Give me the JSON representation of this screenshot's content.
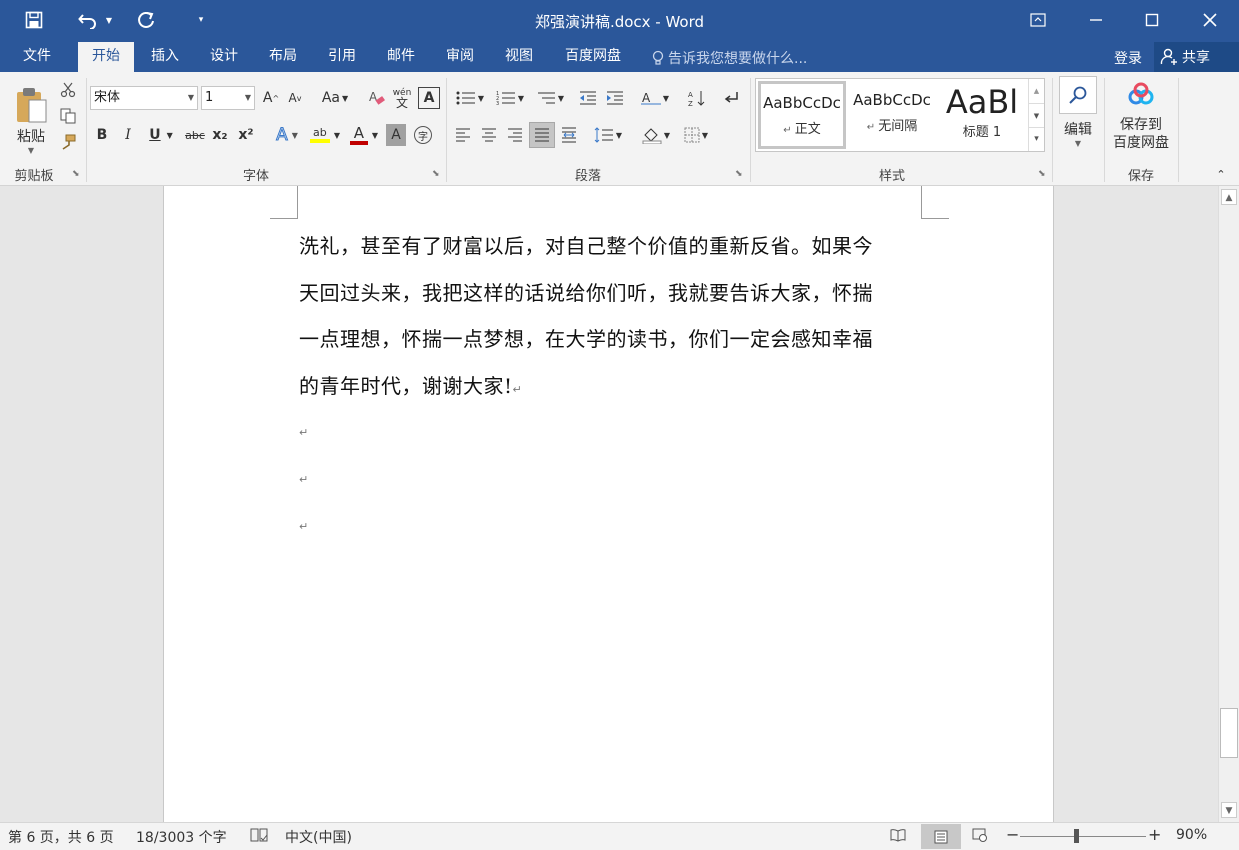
{
  "titlebar": {
    "title": "郑强演讲稿.docx - Word",
    "qa_save": "save-icon",
    "qa_undo": "undo-icon",
    "qa_redo": "redo-icon",
    "qa_custom": "customize-icon"
  },
  "tabs": [
    {
      "label": "文件"
    },
    {
      "label": "开始",
      "active": true
    },
    {
      "label": "插入"
    },
    {
      "label": "设计"
    },
    {
      "label": "布局"
    },
    {
      "label": "引用"
    },
    {
      "label": "邮件"
    },
    {
      "label": "审阅"
    },
    {
      "label": "视图"
    },
    {
      "label": "百度网盘"
    }
  ],
  "tell_me": "告诉我您想要做什么...",
  "login": "登录",
  "share": "共享",
  "clipboard": {
    "paste_label": "粘贴",
    "group_label": "剪贴板"
  },
  "font": {
    "font_name": "宋体",
    "font_size": "1",
    "change_case": "Aa",
    "phonetic": "wén",
    "border_char": "A",
    "bold": "B",
    "italic": "I",
    "underline": "U",
    "strike": "abc",
    "subscript": "x₂",
    "superscript": "x²",
    "text_effect": "A",
    "highlight": "ab",
    "font_color": "A",
    "shading": "A",
    "enclose": "字",
    "grow": "A",
    "shrink": "A",
    "group_label": "字体"
  },
  "paragraph": {
    "group_label": "段落"
  },
  "styles": {
    "items": [
      {
        "sample": "AaBbCcDc",
        "name": "正文"
      },
      {
        "sample": "AaBbCcDc",
        "name": "无间隔"
      },
      {
        "sample": "AaBl",
        "name": "标题 1"
      }
    ],
    "group_label": "样式"
  },
  "editing": {
    "label": "编辑"
  },
  "save": {
    "label_line1": "保存到",
    "label_line2": "百度网盘",
    "group_label": "保存"
  },
  "document": {
    "lines": [
      "洗礼，甚至有了财富以后，对自己整个价值的重新反省。如果今",
      "天回过头来，我把这样的话说给你们听，我就要告诉大家，怀揣",
      "一点理想，怀揣一点梦想，在大学的读书，你们一定会感知幸福",
      "的青年时代，谢谢大家!"
    ],
    "para_mark": "↵"
  },
  "statusbar": {
    "page": "第 6 页，共 6 页",
    "words": "18/3003 个字",
    "language": "中文(中国)",
    "zoom": "90%",
    "zoom_percent": 90
  },
  "colors": {
    "accent": "#2b579a",
    "ribbon": "#f3f3f3",
    "highlight_yellow": "#ffff00",
    "font_red": "#c00000"
  }
}
